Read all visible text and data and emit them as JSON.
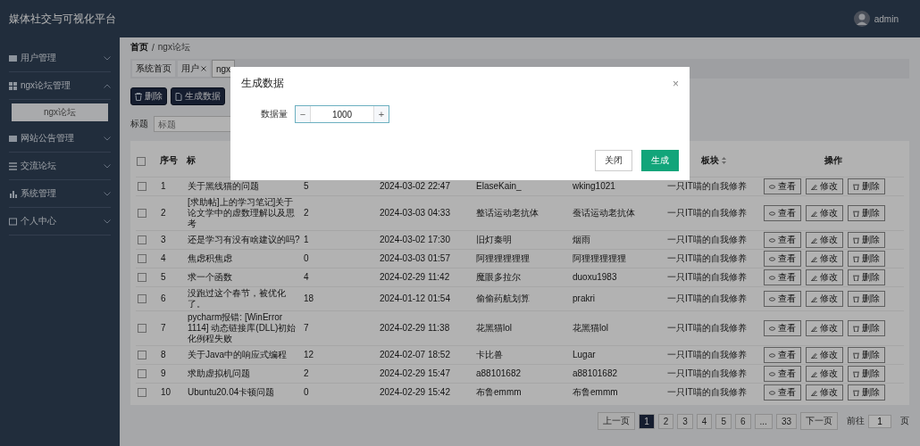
{
  "header": {
    "title": "媒体社交与可视化平台",
    "user": "admin"
  },
  "sidebar": {
    "items": [
      {
        "label": "用户管理",
        "expanded": false
      },
      {
        "label": "ngx论坛管理",
        "expanded": true,
        "children": [
          {
            "label": "ngx论坛",
            "selected": true
          }
        ]
      },
      {
        "label": "网站公告管理",
        "expanded": false
      },
      {
        "label": "交流论坛",
        "expanded": false
      },
      {
        "label": "系统管理",
        "expanded": false
      },
      {
        "label": "个人中心",
        "expanded": false
      }
    ]
  },
  "breadcrumb": [
    {
      "label": "首页"
    },
    {
      "separator": "/",
      "label": "ngx论坛"
    }
  ],
  "tabs": [
    {
      "label": "系统首页",
      "closable": false,
      "selected": false
    },
    {
      "label": "用户",
      "closable": true,
      "selected": false
    },
    {
      "label": "ngx",
      "closable": false,
      "selected": true
    }
  ],
  "toolbar": [
    "删除",
    "生成数据"
  ],
  "search": {
    "label": "标题",
    "placeholder": "标题"
  },
  "table": {
    "all_checked": false,
    "columns": [
      "序号",
      "标",
      "",
      "",
      "",
      "",
      "板块",
      "操作"
    ],
    "rows": [
      {
        "checked": false,
        "cells": [
          "1",
          "关于黑线猫的问题",
          "5",
          "2024-03-02 22:47",
          "ElaseKain_",
          "wking1021",
          "一只IT喵的自我修养"
        ],
        "actions": [
          "查看",
          "修改",
          "删除"
        ]
      },
      {
        "checked": false,
        "cells": [
          "2",
          "[求助帖]上的学习笔记]关于论文学中的虚数理解以及思考",
          "2",
          "2024-03-03 04:33",
          "整话运动老抗体",
          "蚕话运动老抗体",
          "一只IT喵的自我修养"
        ],
        "actions": [
          "查看",
          "修改",
          "删除"
        ]
      },
      {
        "checked": false,
        "cells": [
          "3",
          "还是学习有没有啥建议的吗?",
          "1",
          "2024-03-02 17:30",
          "旧灯秦明",
          "烟雨",
          "一只IT喵的自我修养"
        ],
        "actions": [
          "查看",
          "修改",
          "删除"
        ]
      },
      {
        "checked": false,
        "cells": [
          "4",
          "焦虑积焦虑",
          "0",
          "2024-03-03 01:57",
          "阿狸狸狸狸狸",
          "阿狸狸狸狸狸",
          "一只IT喵的自我修养"
        ],
        "actions": [
          "查看",
          "修改",
          "删除"
        ]
      },
      {
        "checked": false,
        "cells": [
          "5",
          "求一个函数",
          "4",
          "2024-02-29 11:42",
          "魔眼多拉尔",
          "duoxu1983",
          "一只IT喵的自我修养"
        ],
        "actions": [
          "查看",
          "修改",
          "删除"
        ]
      },
      {
        "checked": false,
        "cells": [
          "6",
          "没跑过这个春节，被优化了。",
          "18",
          "2024-01-12 01:54",
          "偷偷药航划算",
          "prakri",
          "一只IT喵的自我修养"
        ],
        "actions": [
          "查看",
          "修改",
          "删除"
        ]
      },
      {
        "checked": false,
        "cells": [
          "7",
          "pycharm报错: [WinError 1114] 动态链接库(DLL)初始化例程失败",
          "7",
          "2024-02-29 11:38",
          "花黑猫lol",
          "花黑猫lol",
          "一只IT喵的自我修养"
        ],
        "actions": [
          "查看",
          "修改",
          "删除"
        ]
      },
      {
        "checked": false,
        "cells": [
          "8",
          "关于Java中的响应式编程",
          "12",
          "2024-02-07 18:52",
          "卡比兽",
          "Lugar",
          "一只IT喵的自我修养"
        ],
        "actions": [
          "查看",
          "修改",
          "删除"
        ]
      },
      {
        "checked": false,
        "cells": [
          "9",
          "求助虚拟机问题",
          "2",
          "2024-02-29 15:47",
          "a88101682",
          "a88101682",
          "一只IT喵的自我修养"
        ],
        "actions": [
          "查看",
          "修改",
          "删除"
        ]
      },
      {
        "checked": false,
        "cells": [
          "10",
          "Ubuntu20.04卡顿问题",
          "0",
          "2024-02-29 15:42",
          "布鲁emmm",
          "布鲁emmm",
          "一只IT喵的自我修养"
        ],
        "actions": [
          "查看",
          "修改",
          "删除"
        ]
      }
    ]
  },
  "pagination": {
    "prev": "上一页",
    "pages": [
      {
        "label": "1",
        "selected": true
      },
      {
        "label": "2",
        "selected": false
      },
      {
        "label": "3",
        "selected": false
      },
      {
        "label": "4",
        "selected": false
      },
      {
        "label": "5",
        "selected": false
      },
      {
        "label": "6",
        "selected": false
      },
      {
        "label": "...",
        "selected": false
      },
      {
        "label": "33",
        "selected": false
      }
    ],
    "next": "下一页",
    "goto": "前往",
    "goto_input": "1",
    "unit": "页"
  },
  "dialog": {
    "title": "生成数据",
    "close": "×",
    "field_label": "数据量",
    "minus": "−",
    "value": "1000",
    "plus": "+",
    "buttons": [
      {
        "label": "关闭",
        "kind": "default"
      },
      {
        "label": "生成",
        "kind": "primary"
      }
    ]
  }
}
